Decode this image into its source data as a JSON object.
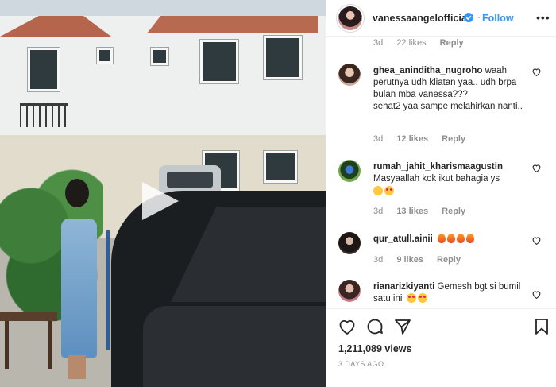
{
  "post": {
    "username": "vanessaangelofficial",
    "verified": true,
    "follow_label": "Follow",
    "more_label": "•••"
  },
  "partial_row": {
    "time": "3d",
    "likes": "22 likes",
    "reply": "Reply"
  },
  "comments": [
    {
      "username": "ghea_aninditha_nugroho",
      "text": "waah perutnya udh kliatan yaa.. udh brpa bulan mba vanessa???\nsehat2 yaa sampe melahirkan nanti..",
      "time": "3d",
      "likes": "12 likes",
      "reply": "Reply"
    },
    {
      "username": "rumah_jahit_kharismaagustin",
      "text": "Masyaallah kok ikut bahagia ys",
      "emojis": [
        "smiling-face-emoji",
        "heart-eyes-emoji"
      ],
      "time": "3d",
      "likes": "13 likes",
      "reply": "Reply"
    },
    {
      "username": "qur_atull.ainii",
      "text": "",
      "emojis": [
        "fire-emoji",
        "fire-emoji",
        "fire-emoji",
        "fire-emoji"
      ],
      "time": "3d",
      "likes": "9 likes",
      "reply": "Reply"
    },
    {
      "username": "rianarizkiyanti",
      "text": "Gemesh bgt si bumil satu ini",
      "emojis": [
        "heart-eyes-emoji",
        "heart-eyes-emoji"
      ]
    }
  ],
  "actions": {
    "icons": [
      "heart-icon",
      "comment-icon",
      "share-icon",
      "bookmark-icon"
    ],
    "views": "1,211,089 views",
    "posted_ago": "3 DAYS AGO"
  },
  "colors": {
    "accent": "#3897f0",
    "muted": "#8e8e8e",
    "text": "#262626",
    "border": "#efefef"
  }
}
